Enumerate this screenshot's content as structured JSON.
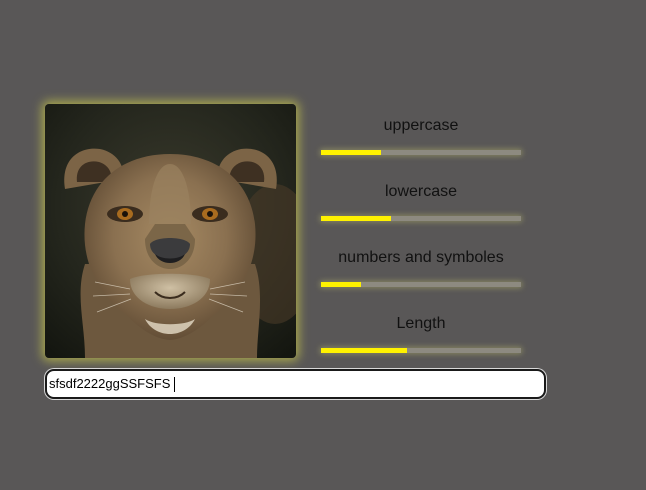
{
  "image": {
    "alt": "lioness"
  },
  "metrics": [
    {
      "label": "uppercase",
      "level": 0.3
    },
    {
      "label": "lowercase",
      "level": 0.35
    },
    {
      "label": "numbers and symboles",
      "level": 0.2
    },
    {
      "label": "Length",
      "level": 0.43
    }
  ],
  "password": {
    "value": "sfsdf2222ggSSFSFS"
  },
  "colors": {
    "background": "#595757",
    "accent": "#fff200",
    "track": "#8d8a80"
  }
}
